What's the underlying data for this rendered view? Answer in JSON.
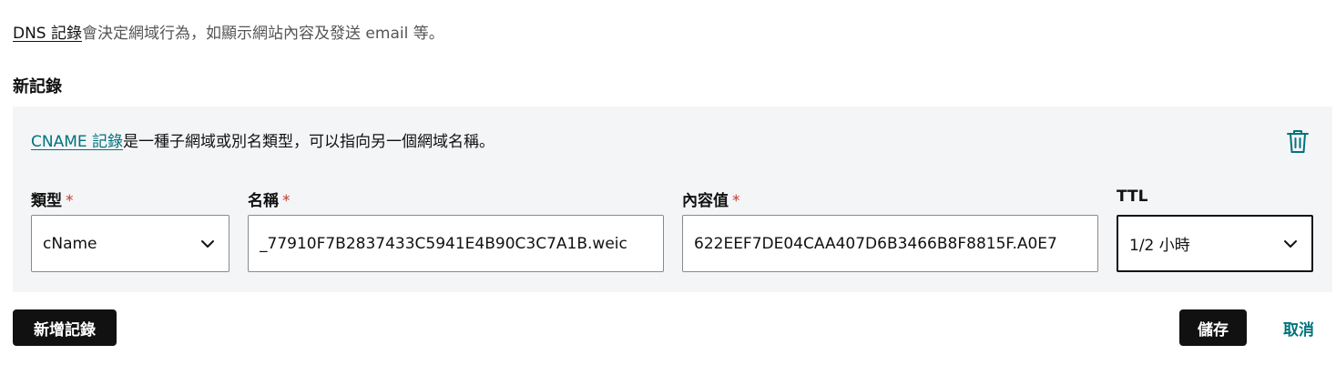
{
  "intro": {
    "link_text": "DNS 記錄",
    "text": "會決定網域行為，如顯示網站內容及發送 email 等。"
  },
  "section_title": "新記錄",
  "record": {
    "desc_link": "CNAME 記錄",
    "desc_text": "是一種子網域或別名類型，可以指向另一個網域名稱。",
    "trash_icon": "trash-icon",
    "fields": {
      "type": {
        "label": "類型",
        "required_mark": "*",
        "value": "cName"
      },
      "name": {
        "label": "名稱",
        "required_mark": "*",
        "value": "_77910F7B2837433C5941E4B90C3C7A1B.weic"
      },
      "content": {
        "label": "內容值",
        "required_mark": "*",
        "value": "622EEF7DE04CAA407D6B3466B8F8815F.A0E7"
      },
      "ttl": {
        "label": "TTL",
        "value": "1/2 小時"
      }
    }
  },
  "buttons": {
    "add": "新增記錄",
    "save": "儲存",
    "cancel": "取消"
  },
  "colors": {
    "link_accent": "#00737d",
    "required": "#c0392b",
    "panel_bg": "#f4f5f7",
    "button_bg": "#111111"
  }
}
